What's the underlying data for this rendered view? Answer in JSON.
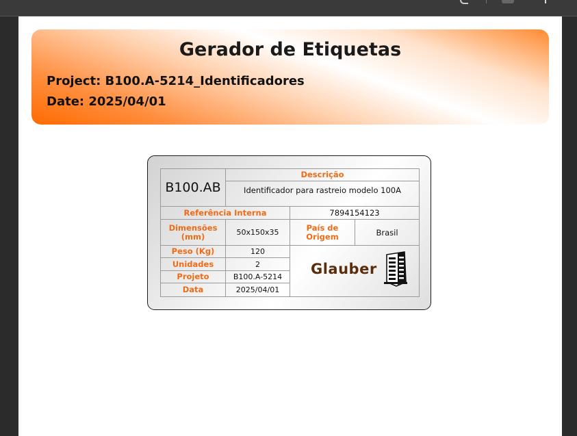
{
  "banner": {
    "title": "Gerador de Etiquetas",
    "project_line": "Project: B100.A-5214_Identificadores",
    "date_line": "Date: 2025/04/01"
  },
  "label": {
    "code": "B100.AB",
    "description_header": "Descrição",
    "description_value": "Identificador para rastreio modelo 100A",
    "ref_header": "Referência Interna",
    "ref_value": "7894154123",
    "dims_header": "Dimensões (mm)",
    "dims_value": "50x150x35",
    "origin_header": "País de Origem",
    "origin_value": "Brasil",
    "weight_header": "Peso (Kg)",
    "weight_value": "120",
    "units_header": "Unidades",
    "units_value": "2",
    "project_header": "Projeto",
    "project_value": "B100.A-5214",
    "date_header": "Data",
    "date_value": "2025/04/01",
    "logo_text": "Glauber",
    "logo_icon": "building-icon"
  },
  "colors": {
    "accent": "#f06b14",
    "banner_orange": "#ff6a00",
    "logo_brown": "#5a2d0c"
  }
}
